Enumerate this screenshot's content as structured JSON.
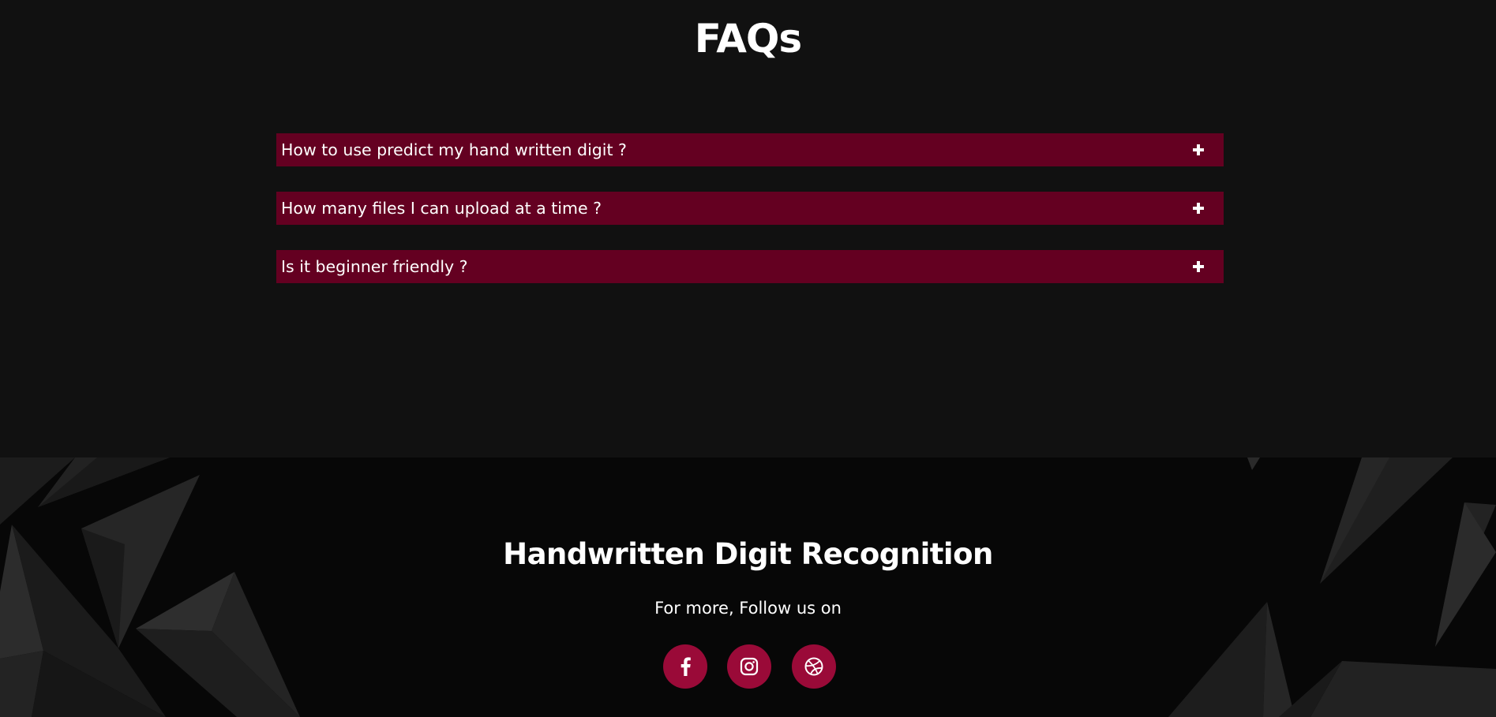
{
  "faq": {
    "title": "FAQs",
    "items": [
      {
        "question": "How to use predict my hand written digit ?",
        "icon": "plus-icon"
      },
      {
        "question": "How many files I can upload at a time ?",
        "icon": "plus-icon"
      },
      {
        "question": "Is it beginner friendly ?",
        "icon": "plus-icon"
      }
    ]
  },
  "footer": {
    "title": "Handwritten Digit Recognition",
    "follow_text": "For more, Follow us on",
    "social": [
      {
        "name": "facebook",
        "icon": "facebook-icon"
      },
      {
        "name": "instagram",
        "icon": "instagram-icon"
      },
      {
        "name": "dribbble",
        "icon": "dribbble-icon"
      }
    ]
  },
  "colors": {
    "page_background": "#111111",
    "footer_background": "#070707",
    "faq_item_background": "#640021",
    "social_button": "#9a0a38",
    "text": "#ffffff"
  }
}
